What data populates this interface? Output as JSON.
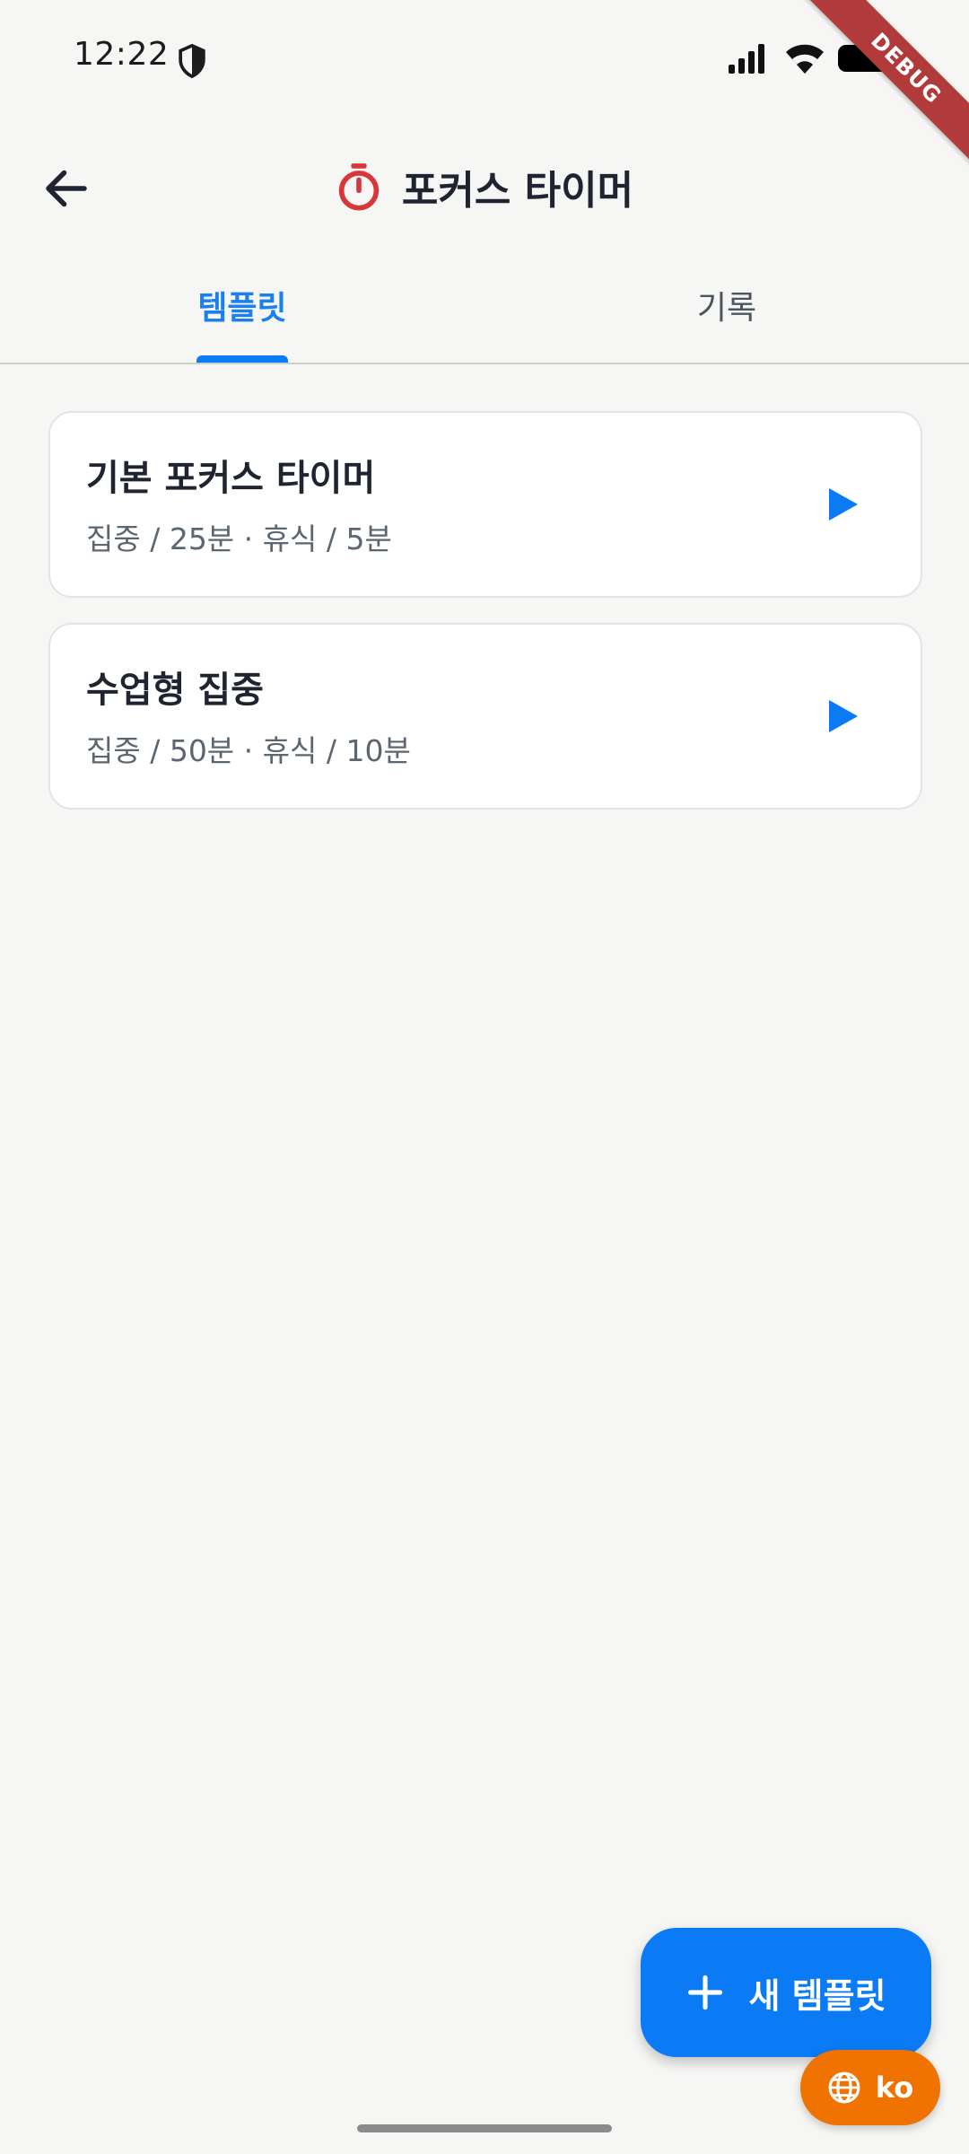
{
  "status_bar": {
    "time": "12:22"
  },
  "debug_banner": "DEBUG",
  "app_bar": {
    "title": "포커스 타이머"
  },
  "tabs": [
    {
      "label": "템플릿",
      "active": true
    },
    {
      "label": "기록",
      "active": false
    }
  ],
  "templates": [
    {
      "title": "기본 포커스 타이머",
      "subtitle": "집중 / 25분 · 휴식 / 5분"
    },
    {
      "title": "수업형 집중",
      "subtitle": "집중 / 50분 · 휴식 / 10분"
    }
  ],
  "fab": {
    "label": "새 템플릿"
  },
  "language": {
    "label": "ko"
  },
  "colors": {
    "accent": "#0a7bf5",
    "timer_icon": "#d9363a",
    "language_button": "#f07200"
  }
}
